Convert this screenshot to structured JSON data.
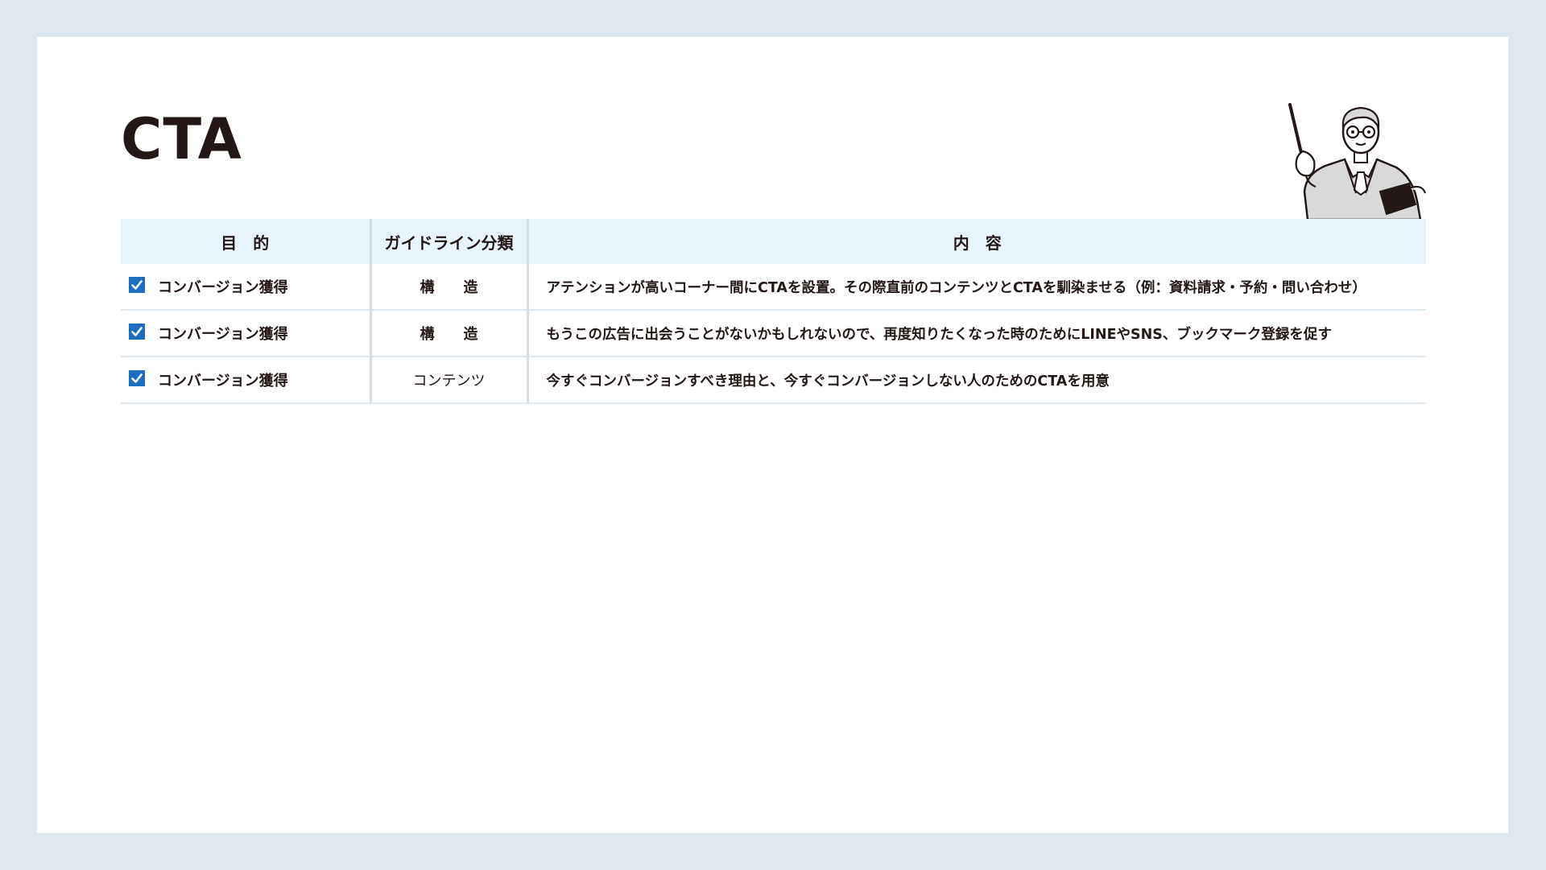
{
  "page": {
    "title": "CTA"
  },
  "table": {
    "headers": {
      "purpose": "目　的",
      "category": "ガイドライン分類",
      "content": "内　容"
    },
    "rows": [
      {
        "checked": true,
        "purpose": "コンバージョン獲得",
        "category": "構　　造",
        "content": "アテンションが高いコーナー間にCTAを設置。その際直前のコンテンツとCTAを馴染ませる（例：資料請求・予約・問い合わせ）"
      },
      {
        "checked": true,
        "purpose": "コンバージョン獲得",
        "category": "構　　造",
        "content": "もうこの広告に出会うことがないかもしれないので、再度知りたくなった時のためにLINEやSNS、ブックマーク登録を促す"
      },
      {
        "checked": true,
        "purpose": "コンバージョン獲得",
        "category": "コンテンツ",
        "content": "今すぐコンバージョンすべき理由と、今すぐコンバージョンしない人のためのCTAを用意"
      }
    ]
  },
  "colors": {
    "background": "#dde7ee",
    "slide": "#ffffff",
    "header_fill": "#e8f4fc",
    "checkbox": "#1a6fc0",
    "text": "#231815",
    "row_divider": "#dce6ed"
  },
  "icons": {
    "checkbox": "checked-box-icon",
    "mascot": "teacher-with-pointer-illustration"
  }
}
